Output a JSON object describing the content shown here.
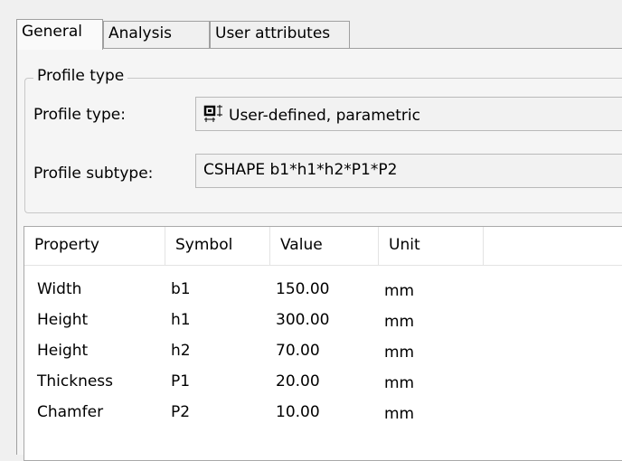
{
  "tabs": [
    {
      "label": "General",
      "active": true
    },
    {
      "label": "Analysis",
      "active": false
    },
    {
      "label": "User attributes",
      "active": false
    }
  ],
  "profile_group": {
    "legend": "Profile type",
    "type_label": "Profile type:",
    "type_value": "User-defined, parametric",
    "type_icon": "parametric-profile-icon",
    "subtype_label": "Profile subtype:",
    "subtype_value": "CSHAPE b1*h1*h2*P1*P2"
  },
  "table": {
    "columns": [
      "Property",
      "Symbol",
      "Value",
      "Unit"
    ],
    "rows": [
      {
        "property": "Width",
        "symbol": "b1",
        "value": "150.00",
        "unit": "mm"
      },
      {
        "property": "Height",
        "symbol": "h1",
        "value": "300.00",
        "unit": "mm"
      },
      {
        "property": "Height",
        "symbol": "h2",
        "value": "70.00",
        "unit": "mm"
      },
      {
        "property": "Thickness",
        "symbol": "P1",
        "value": "20.00",
        "unit": "mm"
      },
      {
        "property": "Chamfer",
        "symbol": "P2",
        "value": "10.00",
        "unit": "mm"
      }
    ]
  },
  "colors": {
    "window_bg": "#f0f0f0",
    "table_bg": "#ffffff",
    "border": "#a0a0a0"
  }
}
